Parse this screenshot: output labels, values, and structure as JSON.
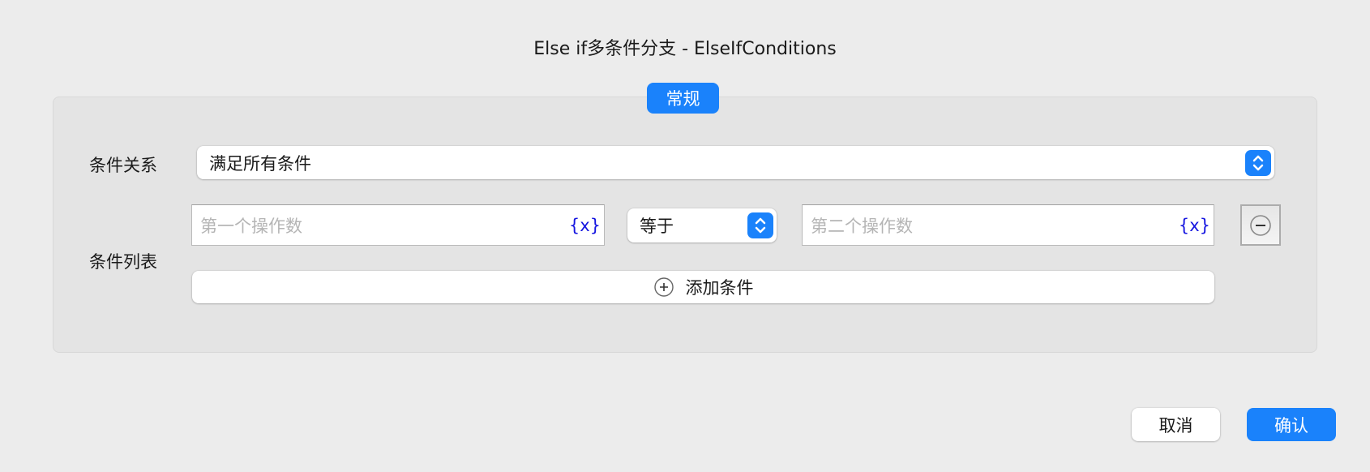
{
  "dialog": {
    "title": "Else if多条件分支 - ElseIfConditions"
  },
  "tabs": [
    {
      "label": "常规",
      "active": true
    }
  ],
  "form": {
    "relation_label": "条件关系",
    "relation_value": "满足所有条件",
    "list_label": "条件列表",
    "conditions": [
      {
        "operand1_placeholder": "第一个操作数",
        "operator": "等于",
        "operand2_placeholder": "第二个操作数",
        "variable_icon": "{x}"
      }
    ],
    "add_condition_label": "添加条件"
  },
  "footer": {
    "cancel": "取消",
    "confirm": "确认"
  },
  "colors": {
    "accent": "#1a82fb",
    "variable": "#1515e0"
  }
}
